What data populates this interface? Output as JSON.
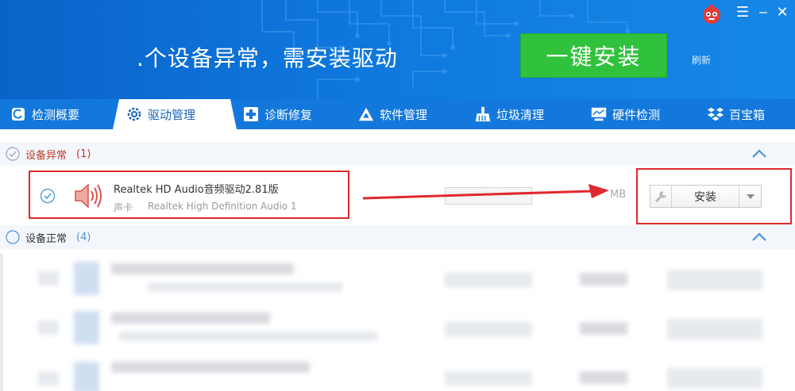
{
  "header": {
    "headline": ".个设备异常，需安装驱动",
    "install_all_label": "一键安装",
    "refresh_label": "刷新",
    "window_controls": [
      "menu-icon",
      "minimize-icon",
      "close-icon"
    ]
  },
  "tabs": [
    {
      "label": "检测概要",
      "icon": "check-overview-icon"
    },
    {
      "label": "驱动管理",
      "icon": "gear-icon",
      "active": true
    },
    {
      "label": "诊断修复",
      "icon": "medical-cross-icon"
    },
    {
      "label": "软件管理",
      "icon": "software-icon"
    },
    {
      "label": "垃圾清理",
      "icon": "broom-icon"
    },
    {
      "label": "硬件检测",
      "icon": "monitor-icon"
    },
    {
      "label": "百宝箱",
      "icon": "toolbox-icon"
    }
  ],
  "sections": {
    "abnormal": {
      "label": "设备异常",
      "count": "(1)"
    },
    "normal": {
      "label": "设备正常",
      "count": "(4)"
    }
  },
  "driver": {
    "name": "Realtek HD Audio音频驱动2.81版",
    "category": "声卡",
    "description": "Realtek High Definition Audio   1",
    "size_suffix": "MB",
    "install_label": "安装"
  },
  "colors": {
    "header_blue": "#0f78dd",
    "install_green": "#31c23d",
    "highlight_red": "#e0282d"
  }
}
